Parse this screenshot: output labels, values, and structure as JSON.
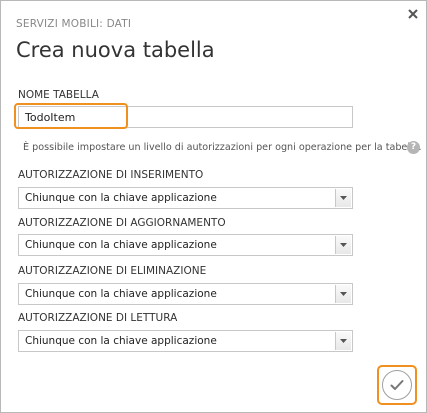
{
  "dialog": {
    "subtitle": "SERVIZI MOBILI: DATI",
    "title": "Crea nuova tabella",
    "close_icon": "close-icon"
  },
  "table_name": {
    "label": "NOME TABELLA",
    "value": "TodoItem"
  },
  "permissions": {
    "help_text": "È possibile impostare un livello di autorizzazioni per ogni operazione per la tabella.",
    "help_icon": "?",
    "fields": [
      {
        "label": "AUTORIZZAZIONE DI INSERIMENTO",
        "value": "Chiunque con la chiave applicazione"
      },
      {
        "label": "AUTORIZZAZIONE DI AGGIORNAMENTO",
        "value": "Chiunque con la chiave applicazione"
      },
      {
        "label": "AUTORIZZAZIONE DI ELIMINAZIONE",
        "value": "Chiunque con la chiave applicazione"
      },
      {
        "label": "AUTORIZZAZIONE DI LETTURA",
        "value": "Chiunque con la chiave applicazione"
      }
    ]
  },
  "footer": {
    "confirm_icon": "checkmark-icon"
  },
  "colors": {
    "highlight": "#f0901e",
    "border": "#c8c8c8",
    "text": "#333333"
  }
}
